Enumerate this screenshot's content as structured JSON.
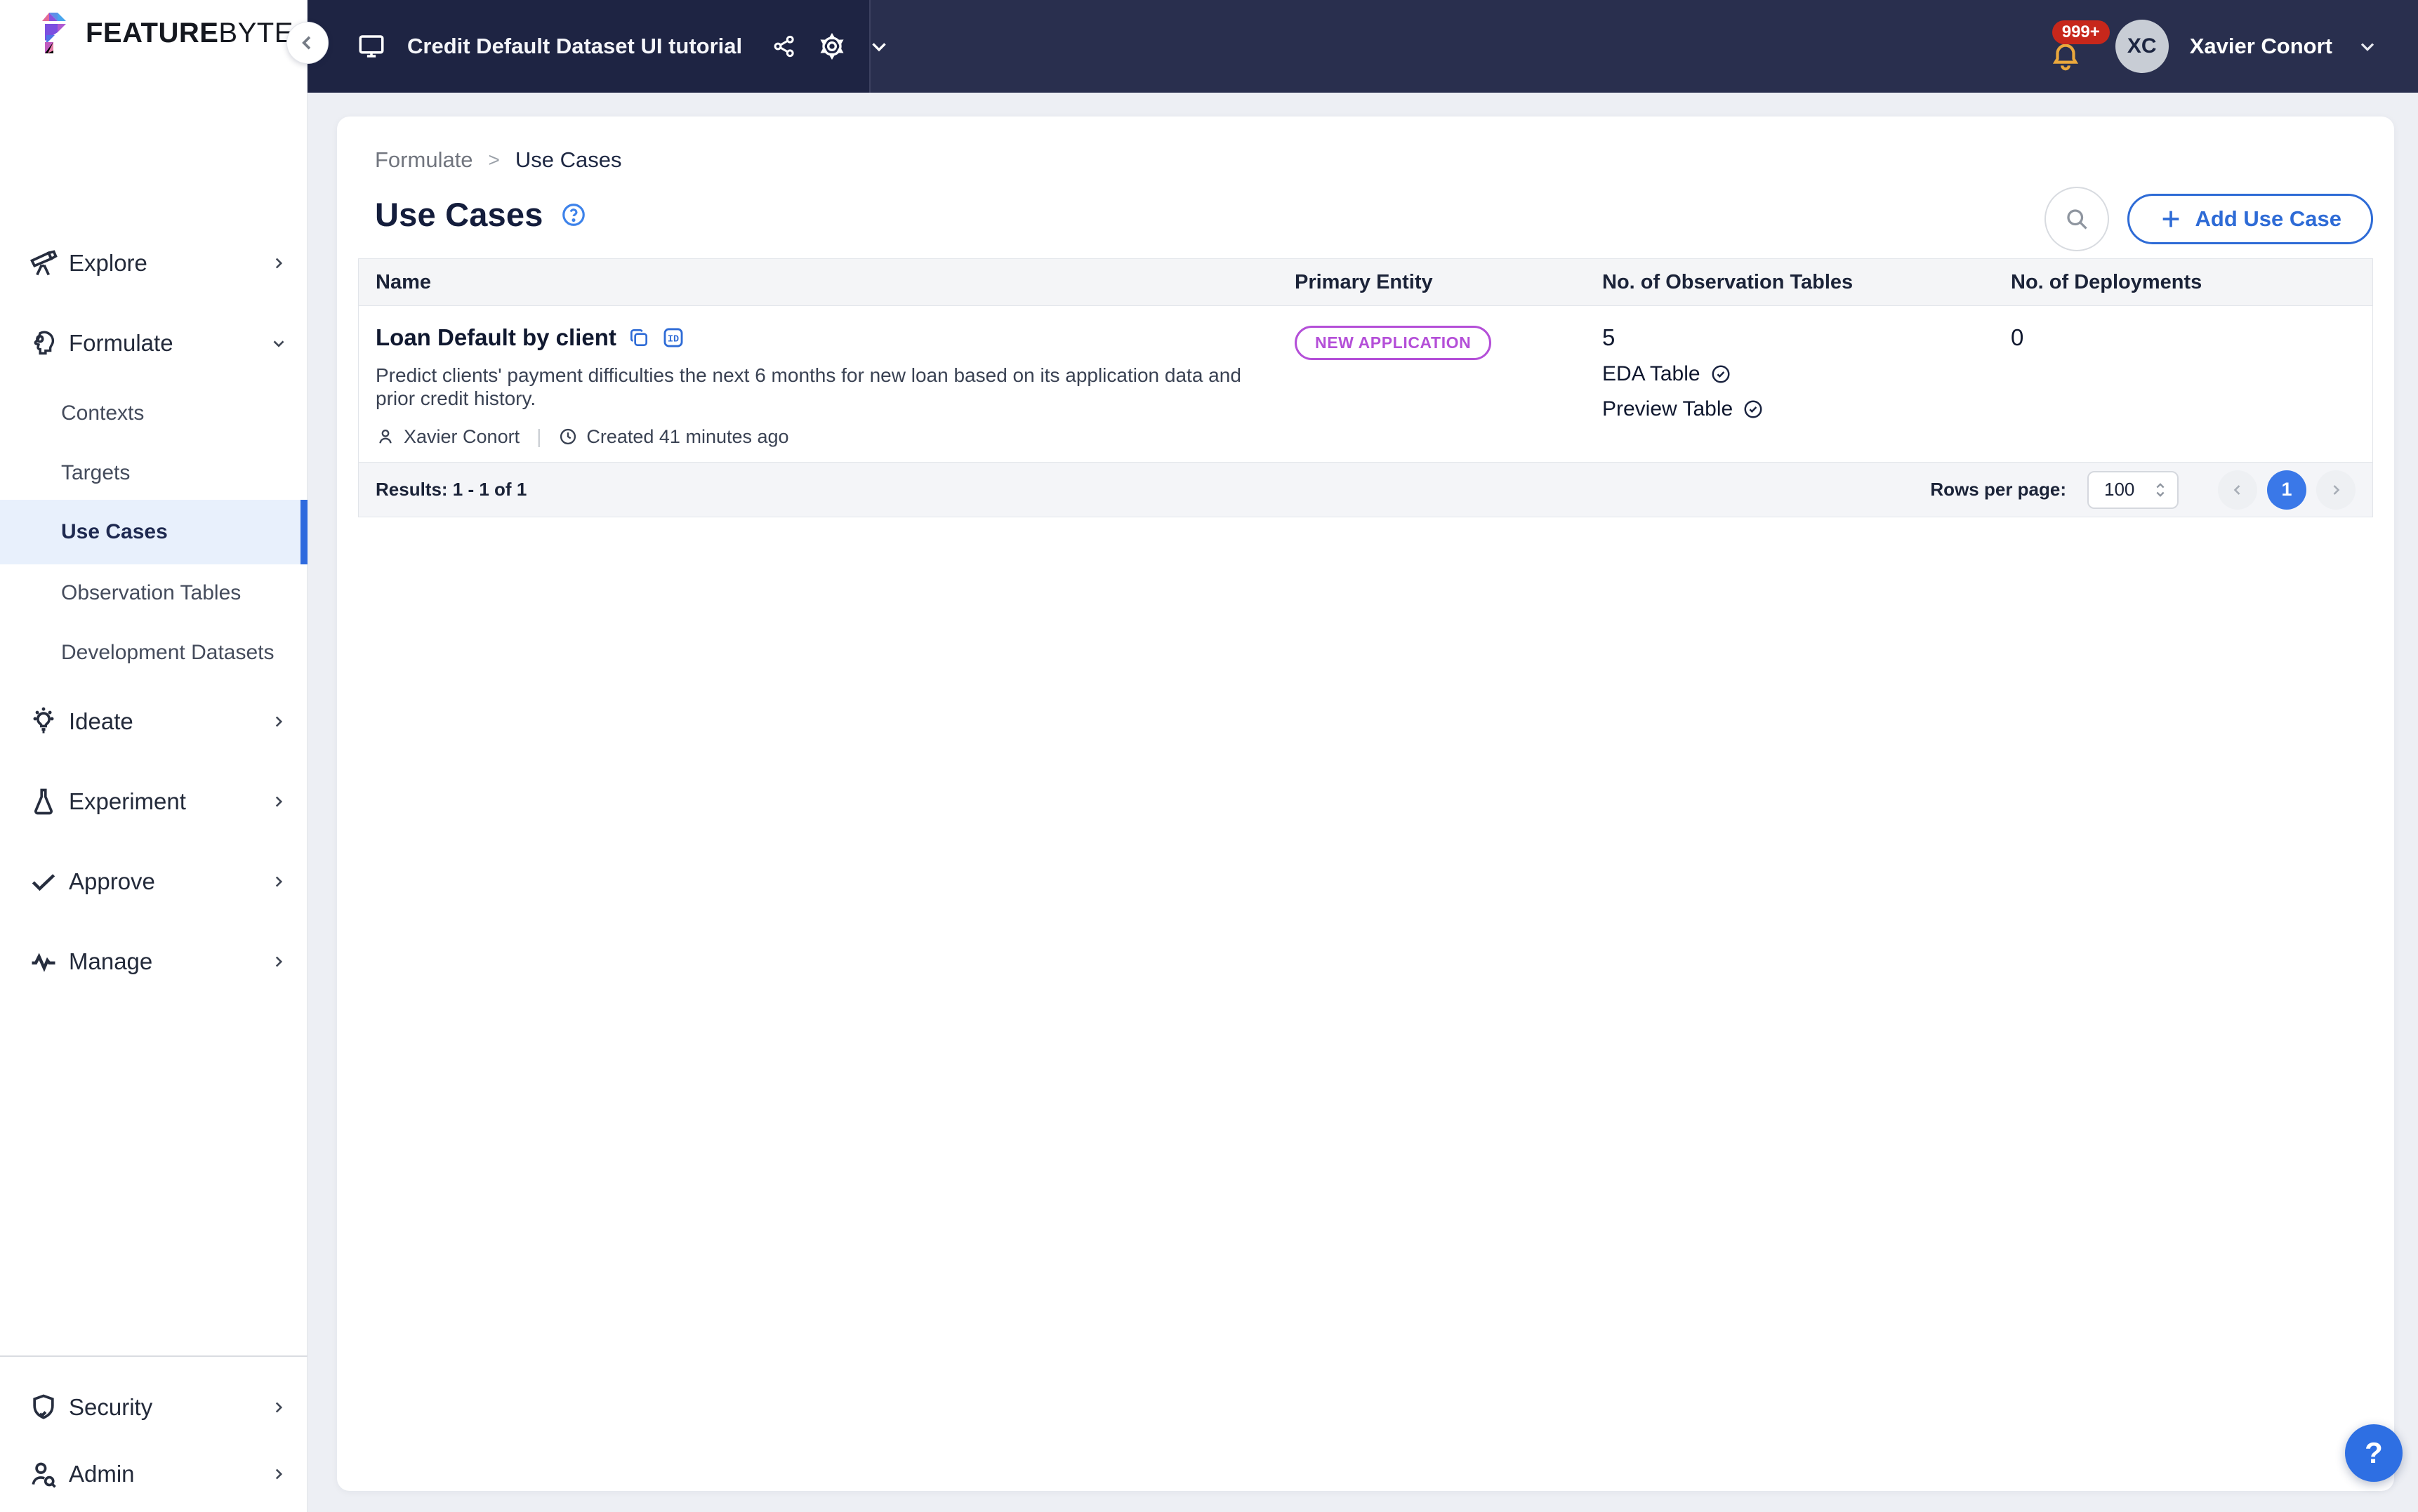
{
  "brand": {
    "name_bold": "FEATURE",
    "name_light": "BYTE"
  },
  "topbar": {
    "project_title": "Credit Default Dataset UI tutorial",
    "notifications_badge": "999+",
    "user_initials": "XC",
    "user_name": "Xavier Conort"
  },
  "sidebar": {
    "items": [
      {
        "label": "Explore",
        "icon": "telescope"
      },
      {
        "label": "Formulate",
        "icon": "brain-gear"
      },
      {
        "label": "Ideate",
        "icon": "lightbulb"
      },
      {
        "label": "Experiment",
        "icon": "flask"
      },
      {
        "label": "Approve",
        "icon": "checkmark"
      },
      {
        "label": "Manage",
        "icon": "activity"
      },
      {
        "label": "Security",
        "icon": "shield-check"
      },
      {
        "label": "Admin",
        "icon": "user-search"
      }
    ],
    "formulate_children": [
      "Contexts",
      "Targets",
      "Use Cases",
      "Observation Tables",
      "Development Datasets"
    ],
    "active_child": "Use Cases"
  },
  "breadcrumb": {
    "parent": "Formulate",
    "separator": ">",
    "current": "Use Cases"
  },
  "page": {
    "title": "Use Cases"
  },
  "actions": {
    "add_use_case": "Add Use Case"
  },
  "table": {
    "columns": [
      "Name",
      "Primary Entity",
      "No. of Observation Tables",
      "No. of Deployments"
    ],
    "rows": [
      {
        "name": "Loan Default by client",
        "description": "Predict clients' payment difficulties the next 6 months for new loan based on its application data and prior credit history.",
        "author": "Xavier Conort",
        "created": "Created 41 minutes ago",
        "primary_entity": "NEW APPLICATION",
        "observation_tables_count": "5",
        "observation_tables": [
          "EDA Table",
          "Preview Table"
        ],
        "deployments_count": "0"
      }
    ],
    "footer": {
      "results": "Results: 1 - 1 of 1",
      "rows_per_page_label": "Rows per page:",
      "rows_per_page_value": "100",
      "current_page": "1"
    }
  },
  "fab": {
    "help": "?"
  },
  "colors": {
    "accent_blue": "#2e6bd6",
    "active_bar_blue": "#2e6ade",
    "badge_purple": "#b44fd8",
    "notification_red": "#c7271b",
    "bell_amber": "#eaa83c",
    "topbar_dark": "#1e2443",
    "topbar_light": "#292f4e",
    "page_bg": "#edeff4",
    "table_header_bg": "#f4f5f7"
  }
}
